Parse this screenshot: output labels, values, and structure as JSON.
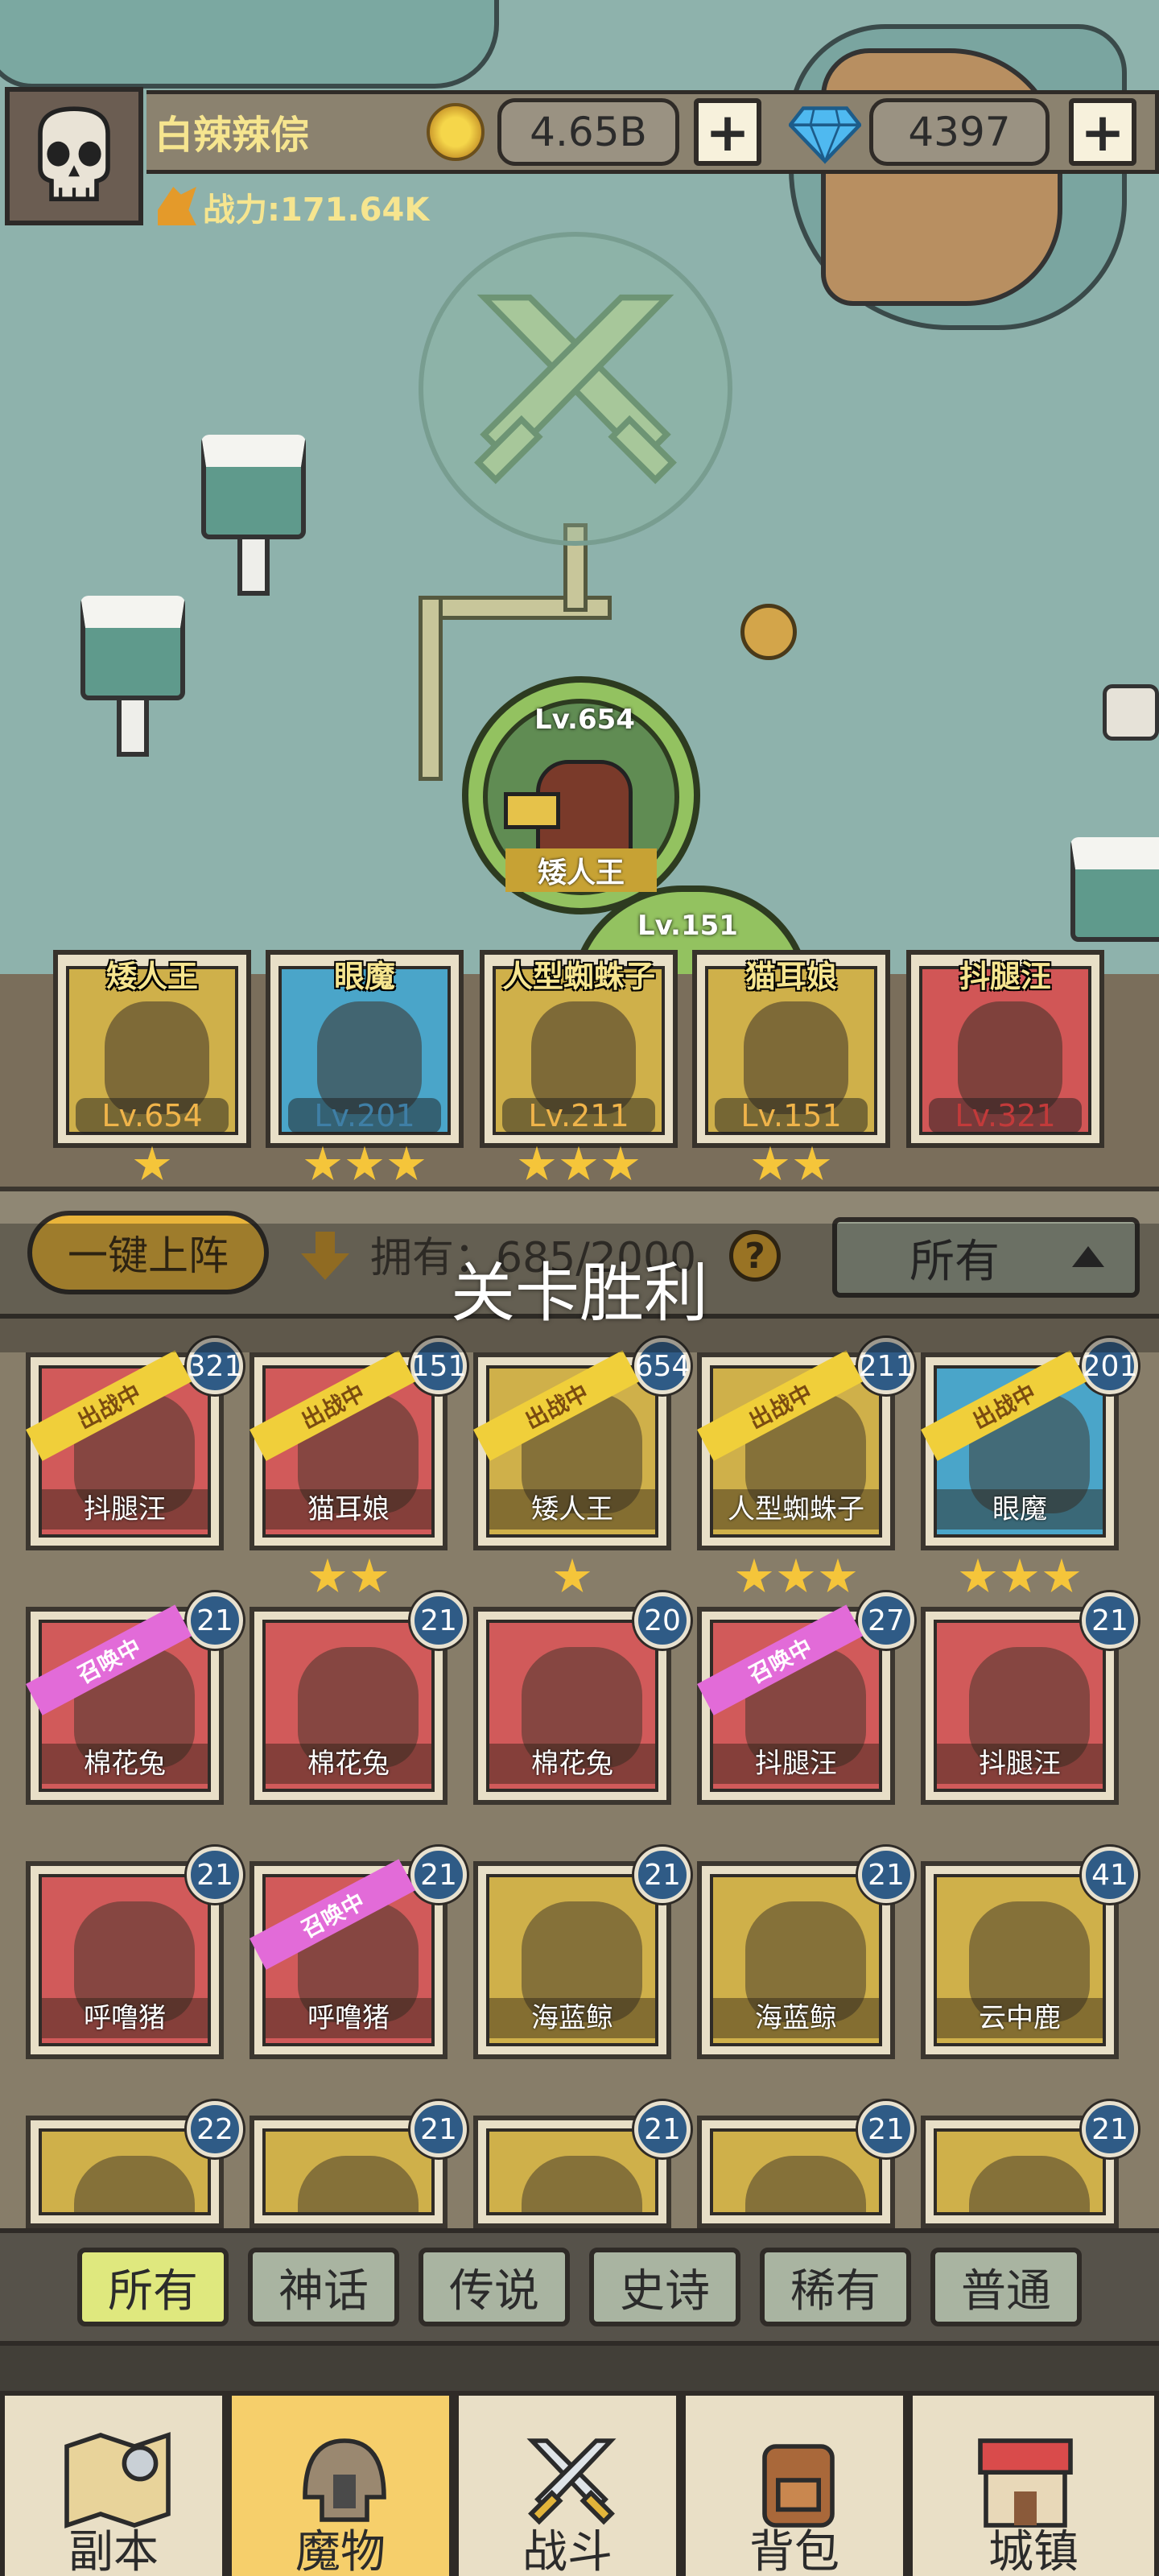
{
  "player": {
    "name": "白辣辣倧",
    "power": "战力:171.64K"
  },
  "currency": {
    "coins": "4.65B",
    "gems": "4397",
    "plus": "+"
  },
  "boss": {
    "level": "Lv.654",
    "name": "矮人王",
    "next_level": "Lv.151"
  },
  "team": [
    {
      "name": "矮人王",
      "level": "Lv.654",
      "stars": 1,
      "bg": "#cfb04a",
      "lvcolor": "#f0b44a"
    },
    {
      "name": "眼魔",
      "level": "Lv.201",
      "stars": 3,
      "bg": "#4aa5c9",
      "lvcolor": "#3f7fa6"
    },
    {
      "name": "人型蜘蛛子",
      "level": "Lv.211",
      "stars": 3,
      "bg": "#cfb04a",
      "lvcolor": "#f0b44a"
    },
    {
      "name": "猫耳娘",
      "level": "Lv.151",
      "stars": 2,
      "bg": "#cfb04a",
      "lvcolor": "#f0b44a"
    },
    {
      "name": "抖腿汪",
      "level": "Lv.321",
      "stars": 0,
      "bg": "#d15656",
      "lvcolor": "#c23a3a"
    }
  ],
  "toolbar": {
    "auto_deploy": "一键上阵",
    "owned_label": "拥有：685/2000",
    "help": "?",
    "filter": "所有"
  },
  "toast": "关卡胜利",
  "roster": [
    {
      "name": "抖腿汪",
      "level": "321",
      "tag": "出战中",
      "tagtype": "battle",
      "stars": 0,
      "bg": "#d15a5a"
    },
    {
      "name": "猫耳娘",
      "level": "151",
      "tag": "出战中",
      "tagtype": "battle",
      "stars": 2,
      "bg": "#d15a5a"
    },
    {
      "name": "矮人王",
      "level": "654",
      "tag": "出战中",
      "tagtype": "battle",
      "stars": 1,
      "bg": "#cfb04a"
    },
    {
      "name": "人型蜘蛛子",
      "level": "211",
      "tag": "出战中",
      "tagtype": "battle",
      "stars": 3,
      "bg": "#cfb04a"
    },
    {
      "name": "眼魔",
      "level": "201",
      "tag": "出战中",
      "tagtype": "battle",
      "stars": 3,
      "bg": "#4aa5c9"
    },
    {
      "name": "棉花兔",
      "level": "21",
      "tag": "召唤中",
      "tagtype": "summon",
      "stars": 0,
      "bg": "#d15a5a"
    },
    {
      "name": "棉花兔",
      "level": "21",
      "tag": "",
      "tagtype": "",
      "stars": 0,
      "bg": "#d15a5a"
    },
    {
      "name": "棉花兔",
      "level": "20",
      "tag": "",
      "tagtype": "",
      "stars": 0,
      "bg": "#d15a5a"
    },
    {
      "name": "抖腿汪",
      "level": "27",
      "tag": "召唤中",
      "tagtype": "summon",
      "stars": 0,
      "bg": "#d15a5a"
    },
    {
      "name": "抖腿汪",
      "level": "21",
      "tag": "",
      "tagtype": "",
      "stars": 0,
      "bg": "#d15a5a"
    },
    {
      "name": "呼噜猪",
      "level": "21",
      "tag": "",
      "tagtype": "",
      "stars": 0,
      "bg": "#d15a5a"
    },
    {
      "name": "呼噜猪",
      "level": "21",
      "tag": "召唤中",
      "tagtype": "summon",
      "stars": 0,
      "bg": "#d15a5a"
    },
    {
      "name": "海蓝鲸",
      "level": "21",
      "tag": "",
      "tagtype": "",
      "stars": 0,
      "bg": "#cfb04a"
    },
    {
      "name": "海蓝鲸",
      "level": "21",
      "tag": "",
      "tagtype": "",
      "stars": 0,
      "bg": "#cfb04a"
    },
    {
      "name": "云中鹿",
      "level": "41",
      "tag": "",
      "tagtype": "",
      "stars": 0,
      "bg": "#cfb04a"
    },
    {
      "name": "",
      "level": "22",
      "tag": "",
      "tagtype": "",
      "stars": 0,
      "bg": "#cfb04a"
    },
    {
      "name": "",
      "level": "21",
      "tag": "",
      "tagtype": "",
      "stars": 0,
      "bg": "#cfb04a"
    },
    {
      "name": "",
      "level": "21",
      "tag": "",
      "tagtype": "",
      "stars": 0,
      "bg": "#cfb04a"
    },
    {
      "name": "",
      "level": "21",
      "tag": "",
      "tagtype": "",
      "stars": 0,
      "bg": "#cfb04a"
    },
    {
      "name": "",
      "level": "21",
      "tag": "",
      "tagtype": "",
      "stars": 0,
      "bg": "#cfb04a"
    }
  ],
  "rarity_tabs": [
    "所有",
    "神话",
    "传说",
    "史诗",
    "稀有",
    "普通"
  ],
  "nav": [
    {
      "label": "副本",
      "icon": "map-icon"
    },
    {
      "label": "魔物",
      "icon": "helmet-icon"
    },
    {
      "label": "战斗",
      "icon": "crossed-swords-icon"
    },
    {
      "label": "背包",
      "icon": "backpack-icon"
    },
    {
      "label": "城镇",
      "icon": "shop-icon"
    }
  ]
}
